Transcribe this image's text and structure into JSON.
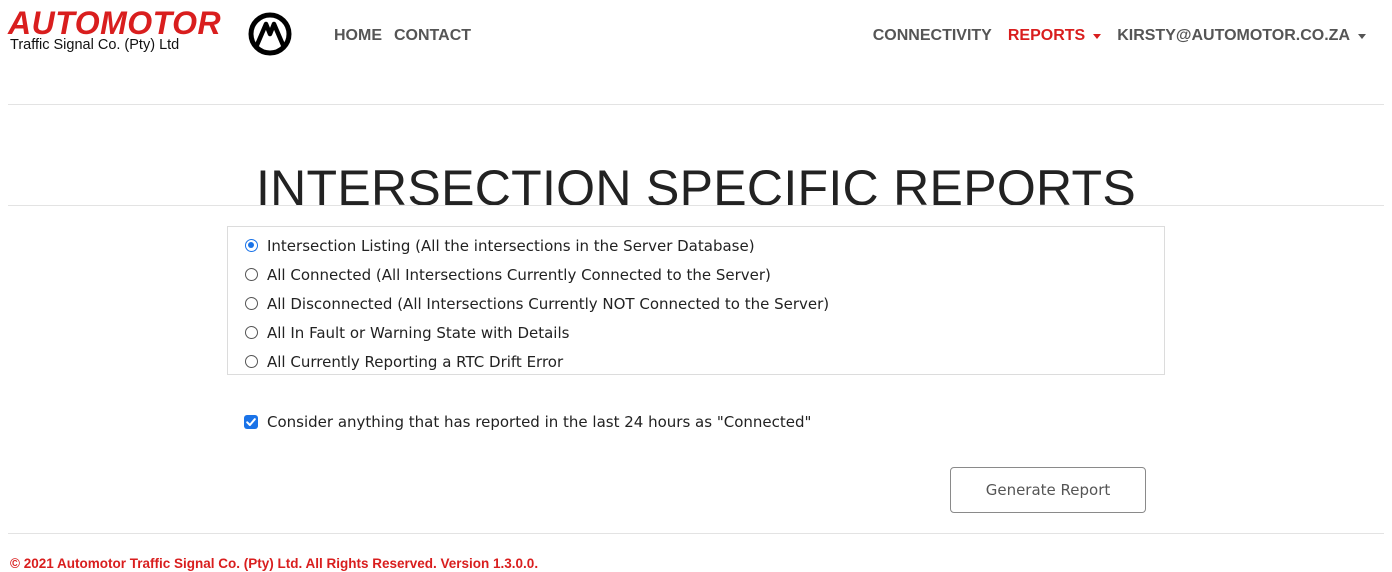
{
  "brand": {
    "wordmark": "AUTOMOTOR",
    "subtitle": "Traffic Signal Co. (Pty) Ltd",
    "emblem_icon": "automotor-emblem-icon",
    "accent_color": "#d91e1e"
  },
  "nav": {
    "left": [
      {
        "label": "HOME"
      },
      {
        "label": "CONTACT"
      }
    ],
    "right": {
      "connectivity": "CONNECTIVITY",
      "reports": "REPORTS",
      "user": "KIRSTY@AUTOMOTOR.CO.ZA"
    }
  },
  "page": {
    "title": "INTERSECTION SPECIFIC REPORTS"
  },
  "report_options": [
    {
      "label": "Intersection Listing (All the intersections in the Server Database)",
      "selected": true
    },
    {
      "label": "All Connected (All Intersections Currently Connected to the Server)",
      "selected": false
    },
    {
      "label": "All Disconnected (All Intersections Currently NOT Connected to the Server)",
      "selected": false
    },
    {
      "label": "All In Fault or Warning State with Details",
      "selected": false
    },
    {
      "label": "All Currently Reporting a RTC Drift Error",
      "selected": false
    }
  ],
  "consider_connected": {
    "label": "Consider anything that has reported in the last 24 hours as \"Connected\"",
    "checked": true
  },
  "generate_button": "Generate Report",
  "footer": "© 2021 Automotor Traffic Signal Co. (Pty) Ltd. All Rights Reserved. Version 1.3.0.0."
}
